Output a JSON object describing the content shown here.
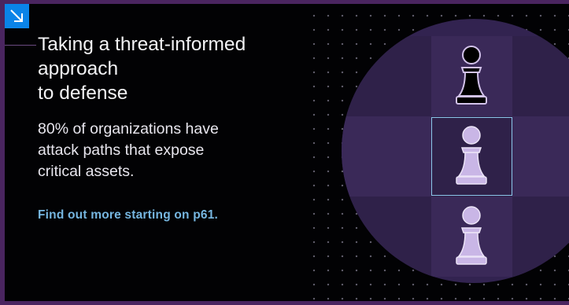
{
  "headline": "Taking a threat-informed\napproach\nto defense",
  "stat": "80% of organizations have\nattack paths that expose\ncritical assets.",
  "link_text": "Find out more starting on p61.",
  "icons": {
    "corner": "arrow-down-right-icon",
    "pawns": "chess-pawn-icon"
  },
  "colors": {
    "accent_blue": "#0a84e8",
    "link": "#76b6e0",
    "frame_purple": "#4a2560",
    "selection_border": "#8cc6ea",
    "pawn_dark": "#000000",
    "pawn_light": "#c9b6e6"
  }
}
